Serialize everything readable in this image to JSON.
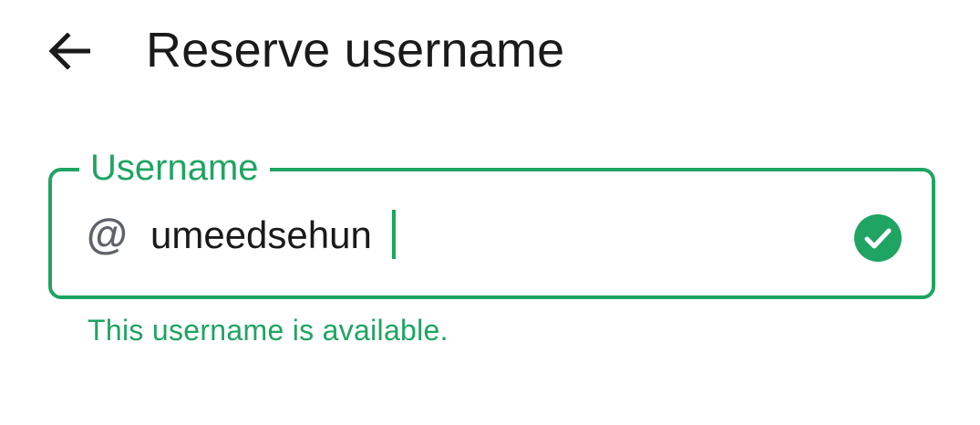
{
  "app_bar": {
    "back_icon": "arrow-left-icon",
    "title": "Reserve username"
  },
  "username_field": {
    "label": "Username",
    "prefix": "@",
    "value": "umeedsehun",
    "status_icon": "check-circle-icon",
    "helper_text": "This username is available."
  },
  "colors": {
    "accent": "#1fa463",
    "text_primary": "#1a1a1a",
    "icon_gray": "#5f6368"
  }
}
